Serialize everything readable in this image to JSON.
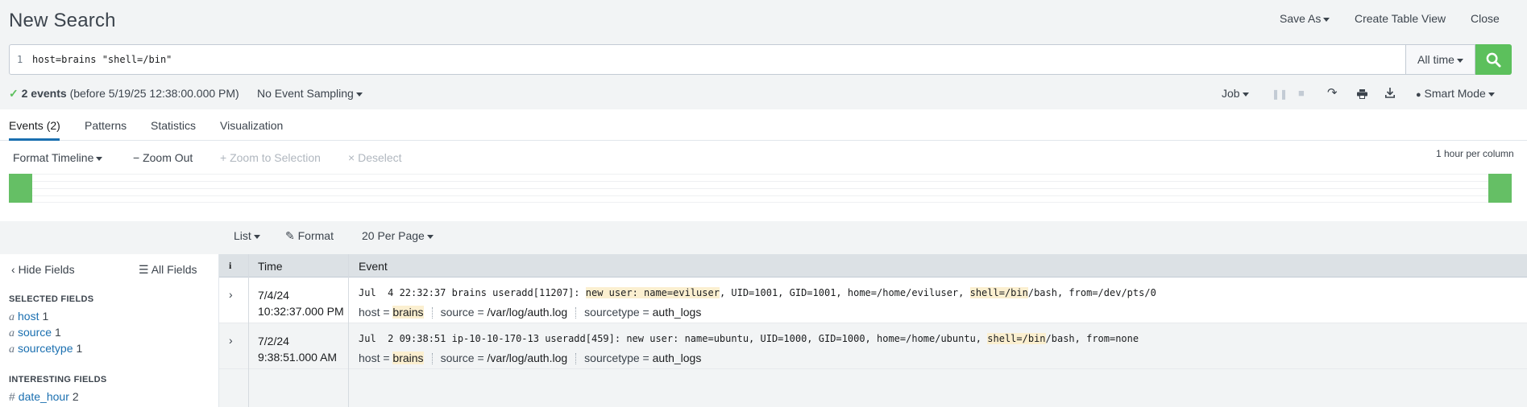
{
  "header": {
    "title": "New Search",
    "save_as": "Save As",
    "create_table_view": "Create Table View",
    "close": "Close"
  },
  "search": {
    "line_number": "1",
    "query": "host=brains \"shell=/bin\"",
    "time_range": "All time",
    "icon": "search-icon"
  },
  "status": {
    "events_count": "2 events",
    "events_suffix": "(before 5/19/25 12:38:00.000 PM)",
    "sampling": "No Event Sampling",
    "job": "Job",
    "mode": "Smart Mode"
  },
  "tabs": [
    {
      "label": "Events (2)",
      "active": true
    },
    {
      "label": "Patterns"
    },
    {
      "label": "Statistics"
    },
    {
      "label": "Visualization"
    }
  ],
  "timeline": {
    "format": "Format Timeline",
    "zoom_out": "Zoom Out",
    "zoom_selection": "+ Zoom to Selection",
    "deselect": "Deselect",
    "per_column": "1 hour per column"
  },
  "results_controls": {
    "list": "List",
    "format": "Format",
    "per_page": "20 Per Page"
  },
  "sidebar": {
    "hide_fields": "Hide Fields",
    "all_fields": "All Fields",
    "selected_title": "SELECTED FIELDS",
    "selected": [
      {
        "type": "a",
        "name": "host",
        "count": "1"
      },
      {
        "type": "a",
        "name": "source",
        "count": "1"
      },
      {
        "type": "a",
        "name": "sourcetype",
        "count": "1"
      }
    ],
    "interesting_title": "INTERESTING FIELDS",
    "interesting": [
      {
        "type": "#",
        "name": "date_hour",
        "count": "2"
      }
    ]
  },
  "table": {
    "col_info": "i",
    "col_time": "Time",
    "col_event": "Event",
    "rows": [
      {
        "date": "7/4/24",
        "time": "10:32:37.000 PM",
        "raw_pre": "Jul  4 22:32:37 brains useradd[11207]: ",
        "raw_hl1": "new user: name=eviluser",
        "raw_mid": ", UID=1001, GID=1001, home=/home/eviluser, ",
        "raw_hl2": "shell=/bin",
        "raw_post": "/bash, from=/dev/pts/0",
        "host_label": "host =",
        "host": "brains",
        "source_label": "source =",
        "source": "/var/log/auth.log",
        "sourcetype_label": "sourcetype =",
        "sourcetype": "auth_logs"
      },
      {
        "date": "7/2/24",
        "time": "9:38:51.000 AM",
        "raw_pre": "Jul  2 09:38:51 ip-10-10-170-13 useradd[459]: new user: name=ubuntu, UID=1000, GID=1000, home=/home/ubuntu, ",
        "raw_hl2": "shell=/bin",
        "raw_post": "/bash, from=none",
        "host_label": "host =",
        "host": "brains",
        "source_label": "source =",
        "source": "/var/log/auth.log",
        "sourcetype_label": "sourcetype =",
        "sourcetype": "auth_logs"
      }
    ]
  }
}
